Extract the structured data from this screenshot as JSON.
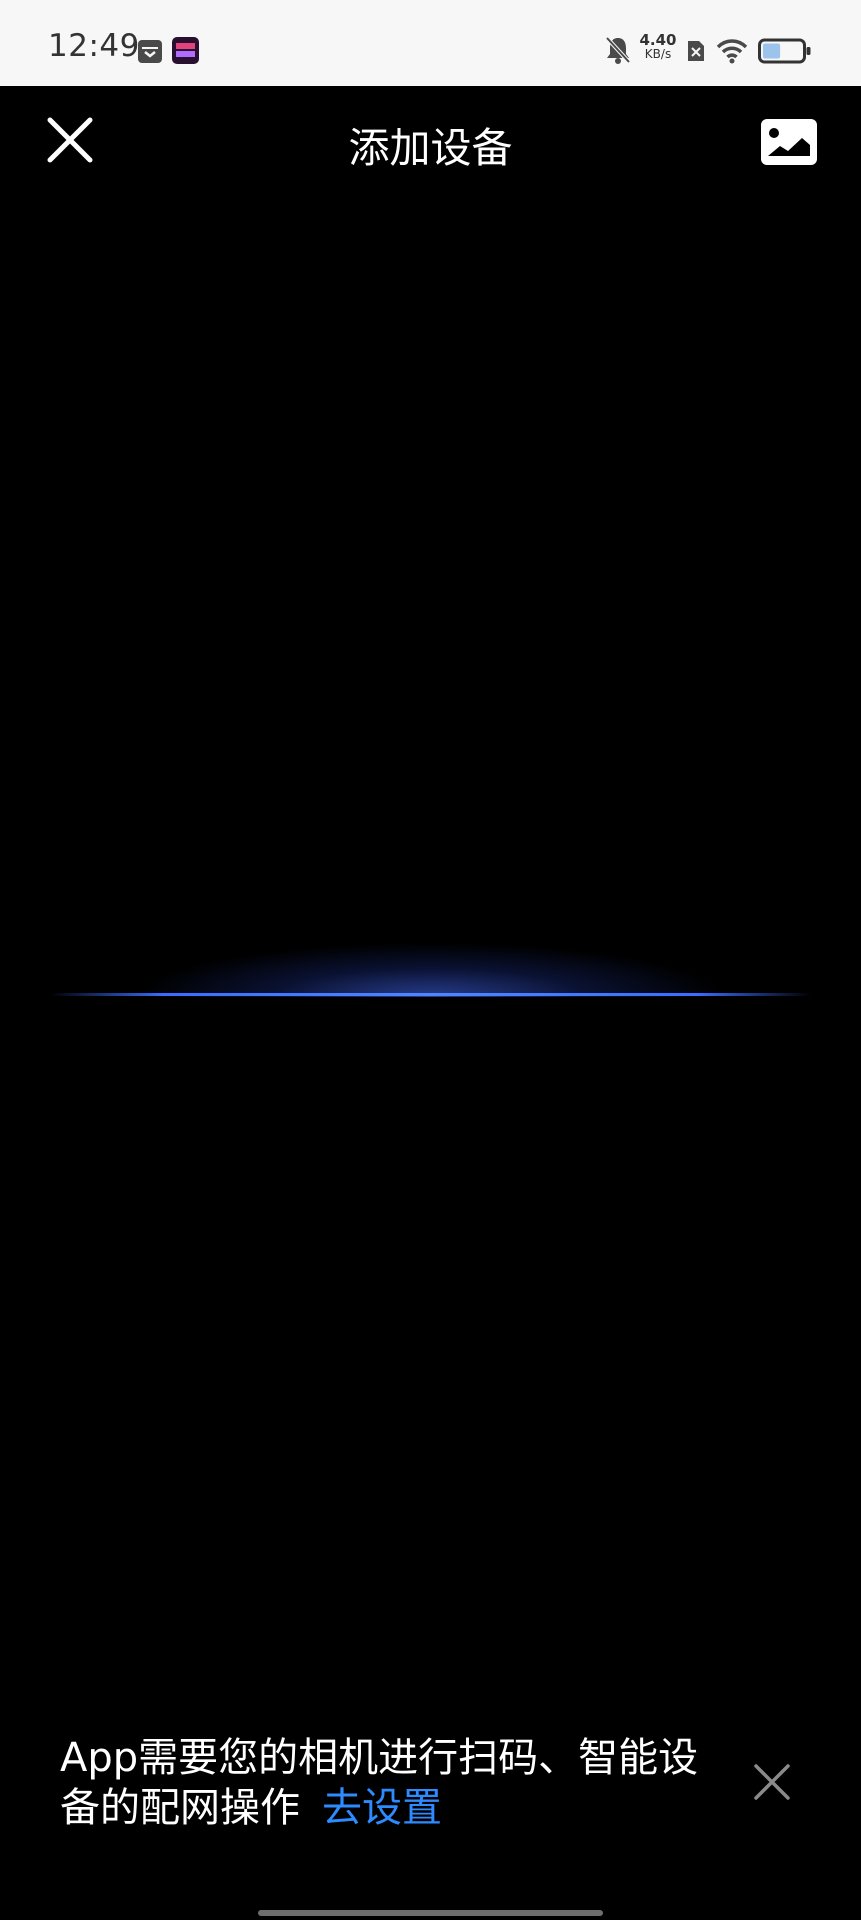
{
  "status_bar": {
    "time": "12:49",
    "net_speed_value": "4.40",
    "net_speed_unit": "KB/s",
    "icons": [
      "calendar-icon",
      "app-notification-icon",
      "mute-bell-icon",
      "sim-disabled-icon",
      "wifi-icon",
      "battery-icon"
    ],
    "battery_level_percent": 45
  },
  "header": {
    "title": "添加设备",
    "close_icon": "close-icon",
    "gallery_icon": "gallery-image-icon"
  },
  "scanner": {
    "accent_color": "#3a6dff"
  },
  "permission_banner": {
    "message": "App需要您的相机进行扫码、智能设备的配网操作",
    "link_label": "去设置",
    "link_color": "#2e8bff",
    "close_icon": "close-icon"
  }
}
